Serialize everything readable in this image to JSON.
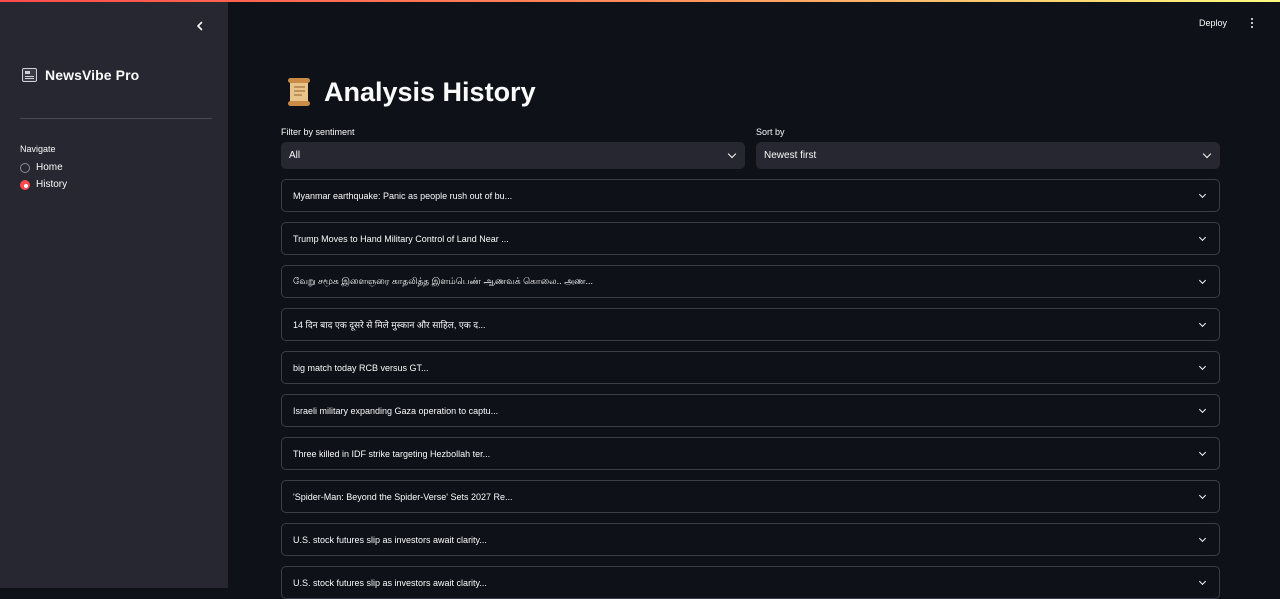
{
  "app": {
    "name": "NewsVibe Pro",
    "deploy_label": "Deploy"
  },
  "sidebar": {
    "nav_label": "Navigate",
    "items": [
      {
        "label": "Home",
        "selected": false
      },
      {
        "label": "History",
        "selected": true
      }
    ]
  },
  "main": {
    "title": "Analysis History",
    "title_icon": "scroll-icon",
    "filter": {
      "label": "Filter by sentiment",
      "value": "All"
    },
    "sort": {
      "label": "Sort by",
      "value": "Newest first"
    },
    "history_items": [
      "Myanmar earthquake: Panic as people rush out of bu...",
      "Trump Moves to Hand Military Control of Land Near ...",
      "வேறு சமூக இளைஞரை காதலித்த இளம்பெண் ஆணவக் கொலை.. அண...",
      "14 दिन बाद एक दूसरे से मिले मुस्कान और साहिल, एक द...",
      "big match today RCB versus GT...",
      "Israeli military expanding Gaza operation to captu...",
      "Three killed in IDF strike targeting Hezbollah ter...",
      "'Spider-Man: Beyond the Spider-Verse' Sets 2027 Re...",
      "U.S. stock futures slip as investors await clarity...",
      "U.S. stock futures slip as investors await clarity..."
    ]
  },
  "colors": {
    "accent": "#ff4b4b",
    "background": "#0e1117",
    "sidebar": "#262730"
  }
}
